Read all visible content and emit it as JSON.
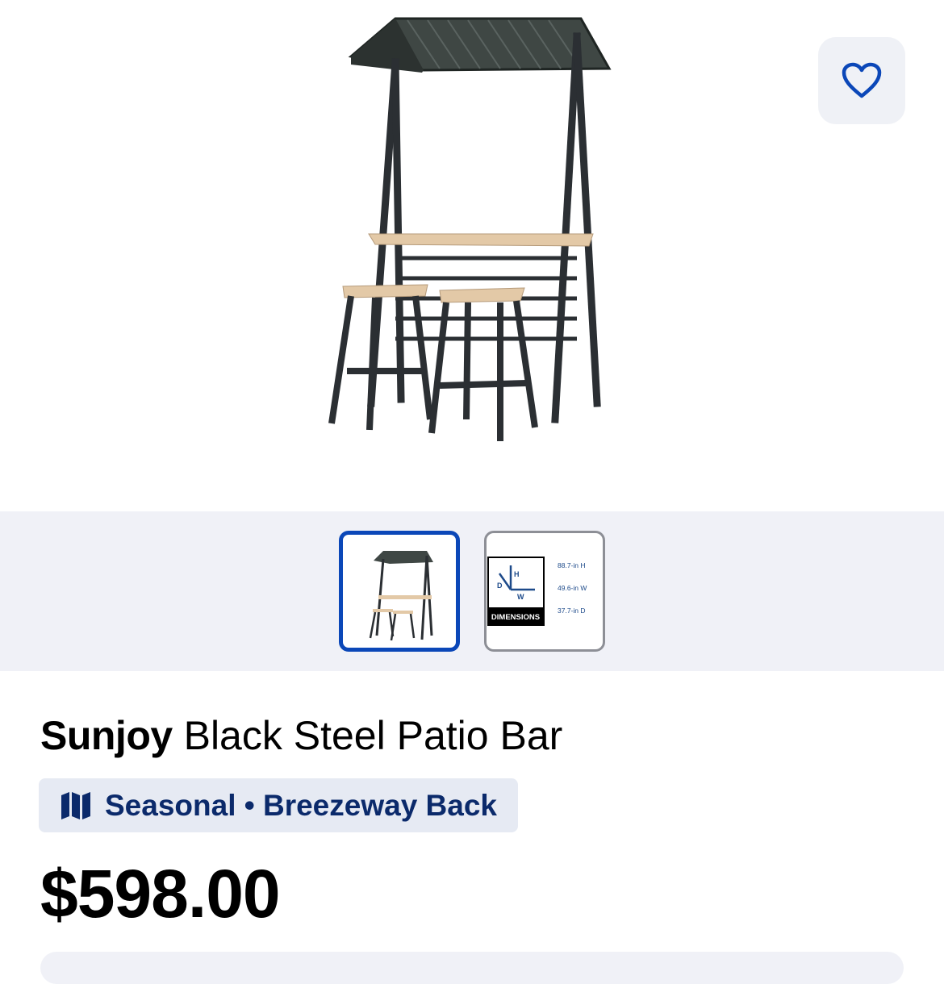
{
  "product": {
    "brand": "Sunjoy",
    "name": "Black Steel Patio Bar",
    "price": "$598.00",
    "location": "Seasonal • Breezeway Back"
  },
  "icons": {
    "favorite": "heart-outline-icon",
    "location": "map-icon"
  },
  "thumbnails": [
    {
      "label": "product-image",
      "selected": true
    },
    {
      "label": "dimensions-image",
      "selected": false,
      "tag": "DIMENSIONS",
      "axes": {
        "h": "H",
        "d": "D",
        "w": "W"
      },
      "specs": [
        "88.7-in H",
        "49.6-in W",
        "37.7-in D"
      ]
    }
  ],
  "colors": {
    "accent": "#0b47b8",
    "location_text": "#0b2a6b",
    "location_bg": "#e6eaf3",
    "strip_bg": "#f0f1f7"
  }
}
